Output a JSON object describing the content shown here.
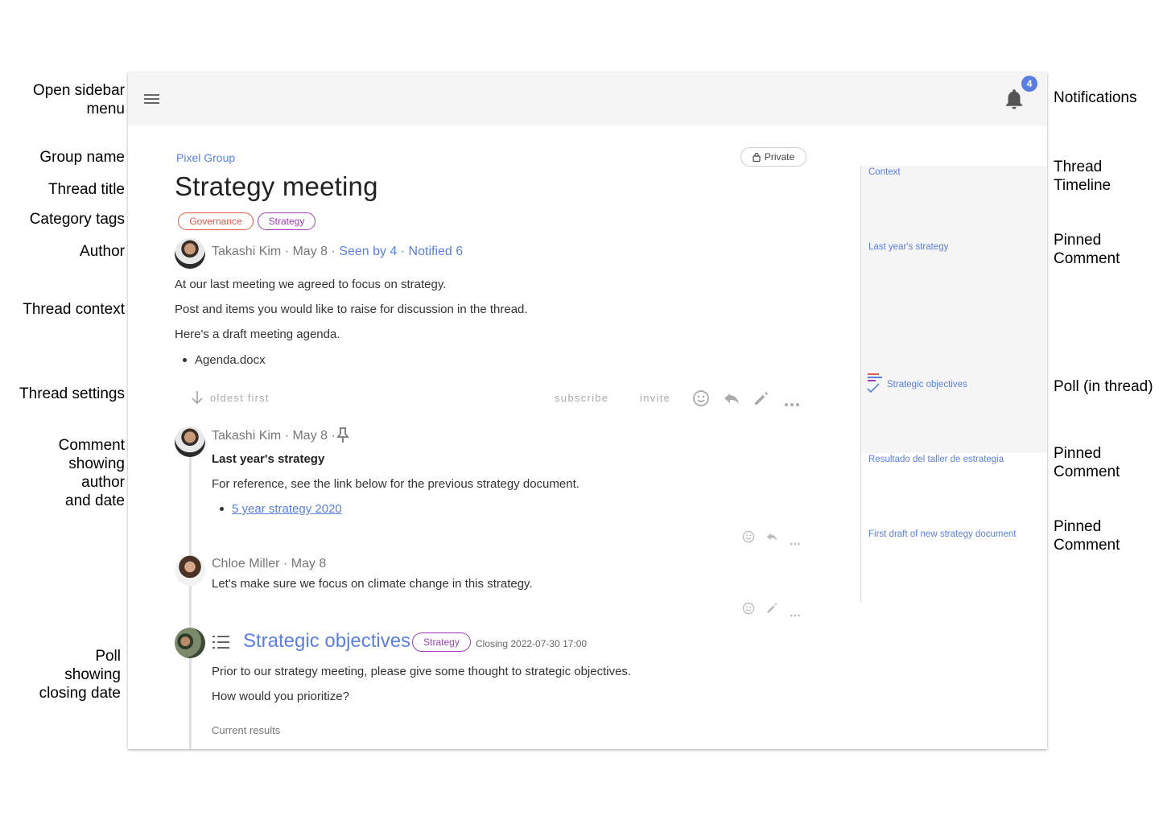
{
  "annotations": {
    "left": {
      "open_sidebar": "Open sidebar\nmenu",
      "group_name": "Group name",
      "thread_title": "Thread title",
      "category_tags": "Category tags",
      "author": "Author",
      "thread_context": "Thread context",
      "thread_settings": "Thread settings",
      "comment_author_date": "Comment\nshowing\nauthor\nand date",
      "poll_closing": "Poll\nshowing\nclosing date"
    },
    "right": {
      "notifications": "Notifications",
      "thread_timeline": "Thread\nTimeline",
      "pinned_1": "Pinned\nComment",
      "poll_in_thread": "Poll (in thread)",
      "pinned_2": "Pinned\nComment",
      "pinned_3": "Pinned\nComment"
    }
  },
  "topbar": {
    "notification_count": "4",
    "icons": [
      "hamburger-menu-icon",
      "bell-icon"
    ]
  },
  "thread": {
    "group_name": "Pixel Group",
    "visibility": "Private",
    "title": "Strategy meeting",
    "tags": [
      "Governance",
      "Strategy"
    ],
    "author": "Takashi Kim",
    "date": "May 8",
    "seen_by": "Seen by 4",
    "notified": "Notified 6",
    "context": {
      "line1": "At our last meeting we agreed to focus on strategy.",
      "line2": "Post and items you would like to raise for discussion in the thread.",
      "line3": "Here's a draft meeting agenda.",
      "attachment": "Agenda.docx"
    }
  },
  "toolbar": {
    "sort_label": "oldest first",
    "subscribe": "subscribe",
    "invite": "invite"
  },
  "comments": [
    {
      "author": "Takashi Kim",
      "date": "May 8",
      "heading": "Last year's strategy",
      "text": "For reference, see the link below for the previous strategy document.",
      "link": "5 year strategy 2020"
    },
    {
      "author": "Chloe Miller",
      "date": "May 8",
      "text": "Let's make sure we focus on climate change in this strategy."
    }
  ],
  "poll": {
    "title": "Strategic objectives",
    "tag": "Strategy",
    "closing": "Closing 2022-07-30 17:00",
    "description": "Prior to our strategy meeting, please give some thought to strategic objectives.",
    "question": "How would you prioritize?",
    "results_label": "Current results"
  },
  "timeline": {
    "items": [
      "Context",
      "Last year's strategy",
      "Strategic objectives",
      "Resultado del taller de estrategia",
      "First draft of new strategy document"
    ]
  },
  "colors": {
    "accent": "#5a7fe0",
    "governance": "#e0574a",
    "strategy": "#9c3fb5",
    "topbar": "#f5f5f5"
  }
}
